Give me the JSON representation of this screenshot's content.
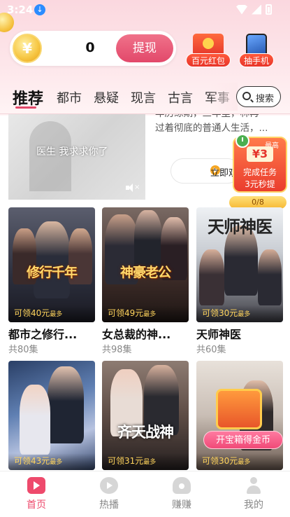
{
  "status_bar": {
    "time": "3:24"
  },
  "wallet": {
    "coin_symbol": "¥",
    "balance": "0",
    "withdraw_label": "提现"
  },
  "promos": [
    {
      "label": "百元红包",
      "icon": "red-envelope-icon"
    },
    {
      "label": "抽手机",
      "icon": "phone-prize-icon"
    }
  ],
  "tabs": {
    "active": "推荐",
    "items": [
      "推荐",
      "都市",
      "悬疑",
      "现言",
      "古言",
      "军事"
    ],
    "search_label": "搜索"
  },
  "featured": {
    "caption": "医生 我求求你了",
    "description_partial": "年历练期，三年里，林再",
    "description": "过着彻底的普通人生活，...",
    "watch_label": "立即观看"
  },
  "task_widget": {
    "max_label": "最高",
    "amount": "¥3",
    "line1": "完成任务",
    "line2": "3元秒提",
    "progress": "0/8"
  },
  "dramas": [
    {
      "title": "都市之修行...",
      "episodes": "共80集",
      "reward": "可领40元",
      "reward_suffix": "最多",
      "poster_text": "修行千年"
    },
    {
      "title": "女总裁的神...",
      "episodes": "共98集",
      "reward": "可领49元",
      "reward_suffix": "最多",
      "poster_text": "神豪老公"
    },
    {
      "title": "天师神医",
      "episodes": "共60集",
      "reward": "可领30元",
      "reward_suffix": "最多",
      "poster_text": "天师神医"
    },
    {
      "title": "",
      "episodes": "",
      "reward": "可领43元",
      "reward_suffix": "最多",
      "poster_text": ""
    },
    {
      "title": "",
      "episodes": "",
      "reward": "可领31元",
      "reward_suffix": "最多",
      "poster_text": "齐天战神"
    },
    {
      "title": "",
      "episodes": "",
      "reward": "可领30元",
      "reward_suffix": "最多",
      "poster_text": ""
    }
  ],
  "chest": {
    "label": "开宝箱得金币"
  },
  "bottom_nav": [
    {
      "label": "首页",
      "icon": "home-play-icon",
      "active": true
    },
    {
      "label": "热播",
      "icon": "play-circle-icon",
      "active": false
    },
    {
      "label": "赚赚",
      "icon": "money-bag-icon",
      "active": false
    },
    {
      "label": "我的",
      "icon": "user-icon",
      "active": false
    }
  ],
  "colors": {
    "accent": "#ee4a6c",
    "gold": "#f7c948",
    "reward_text": "#ffd45c"
  }
}
